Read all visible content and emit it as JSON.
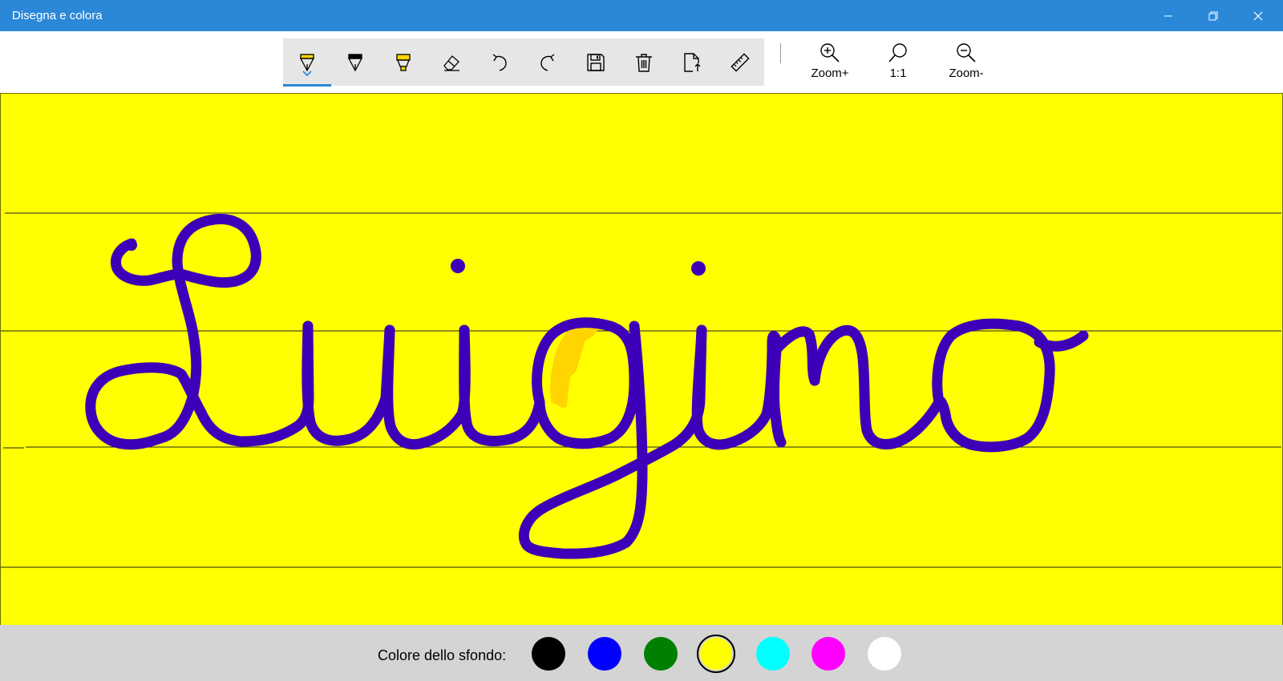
{
  "window": {
    "title": "Disegna e colora",
    "controls": [
      "minimize-icon",
      "restore-icon",
      "close-icon"
    ],
    "accent": "#2b88d8"
  },
  "toolbar": {
    "tools": [
      {
        "icon": "pen-yellow-icon",
        "active": true
      },
      {
        "icon": "pen-black-icon",
        "active": false
      },
      {
        "icon": "highlighter-icon",
        "active": false
      },
      {
        "icon": "eraser-icon",
        "active": false
      },
      {
        "icon": "undo-icon",
        "active": false
      },
      {
        "icon": "redo-icon",
        "active": false
      },
      {
        "icon": "save-icon",
        "active": false
      },
      {
        "icon": "trash-icon",
        "active": false
      },
      {
        "icon": "export-icon",
        "active": false
      },
      {
        "icon": "ruler-icon",
        "active": false
      }
    ],
    "zoom": [
      {
        "icon": "zoom-in-icon",
        "label": "Zoom+"
      },
      {
        "icon": "zoom-reset-icon",
        "label": "1:1"
      },
      {
        "icon": "zoom-out-icon",
        "label": "Zoom-"
      }
    ]
  },
  "canvas": {
    "background_color": "#ffff00",
    "ink_color": "#3d00b8",
    "highlight_color": "#ffd400",
    "lines": 4,
    "handwriting": "Luigino"
  },
  "background_picker": {
    "label": "Colore dello sfondo:",
    "colors": [
      "#000000",
      "#0000ff",
      "#008000",
      "#ffff00",
      "#00ffff",
      "#ff00ff",
      "#ffffff"
    ],
    "selected": "#ffff00"
  }
}
